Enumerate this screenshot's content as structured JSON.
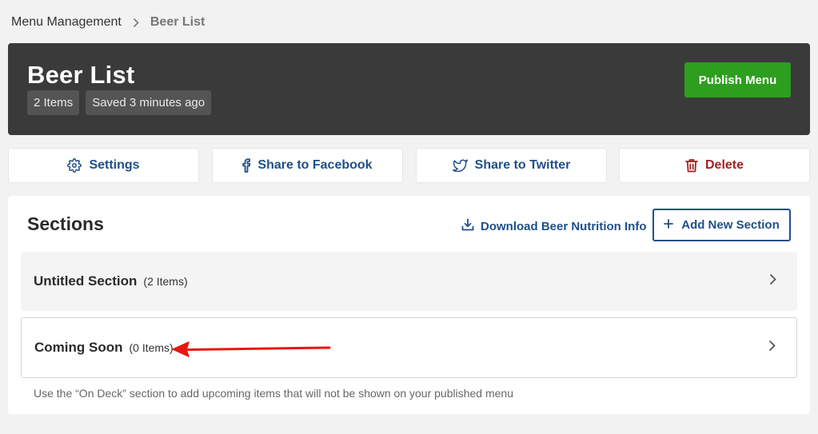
{
  "breadcrumb": {
    "parent": "Menu Management",
    "current": "Beer List",
    "separator_icon": "chevron-right-icon"
  },
  "header": {
    "title": "Beer List",
    "items_badge": "2 Items",
    "saved_badge": "Saved 3 minutes ago",
    "publish_label": "Publish Menu",
    "background_color": "#3a3a3a",
    "publish_color": "#2e9e1f"
  },
  "actions": {
    "settings": {
      "label": "Settings",
      "icon": "gear-icon"
    },
    "facebook": {
      "label": "Share to Facebook",
      "icon": "facebook-icon"
    },
    "twitter": {
      "label": "Share to Twitter",
      "icon": "twitter-icon"
    },
    "delete": {
      "label": "Delete",
      "icon": "trash-icon",
      "color": "#a42222"
    }
  },
  "sections_panel": {
    "title": "Sections",
    "download_label": "Download Beer Nutrition Info",
    "add_section_label": "Add New Section",
    "accent_color": "#1f4f8a",
    "sections": [
      {
        "name": "Untitled Section",
        "count": "(2 Items)"
      },
      {
        "name": "Coming Soon",
        "count": "(0 Items)"
      }
    ],
    "hint": "Use the “On Deck” section to add upcoming items that will not be shown on your published menu"
  },
  "annotation": {
    "icon": "red-arrow-icon",
    "color": "#e8170f"
  }
}
